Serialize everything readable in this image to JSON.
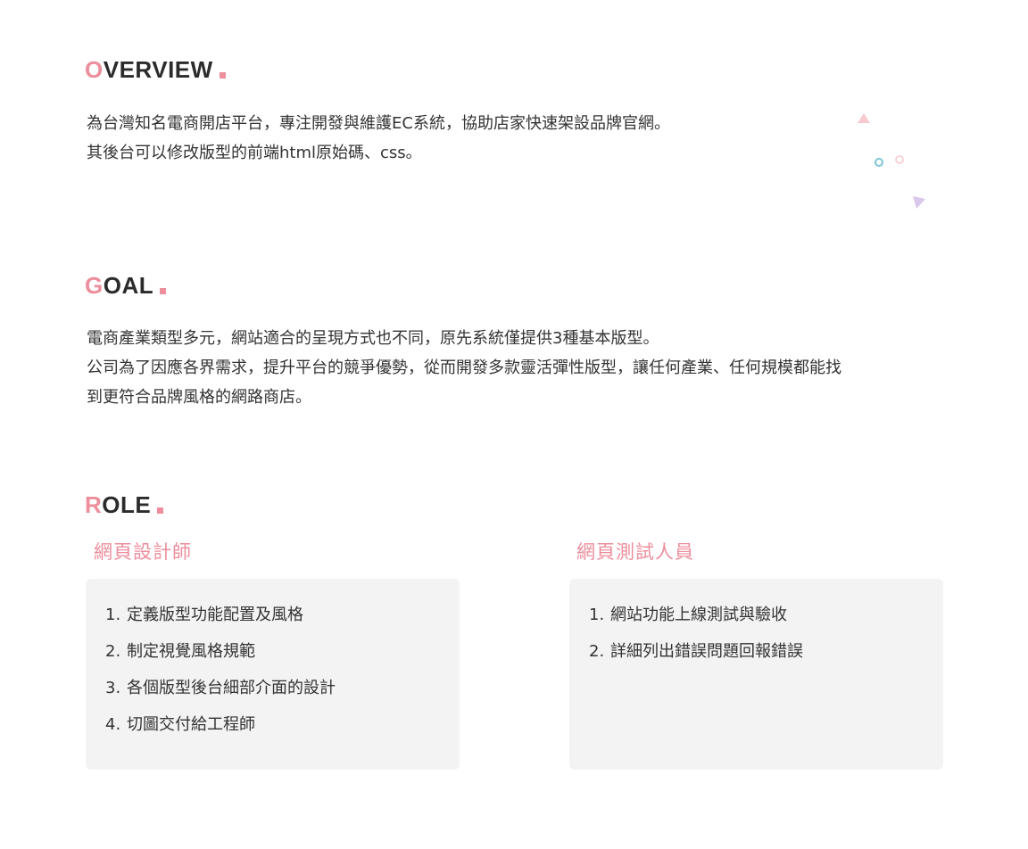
{
  "overview": {
    "initial": "O",
    "title_rest": "VERVIEW",
    "lines": [
      "為台灣知名電商開店平台，專注開發與維護EC系統，協助店家快速架設品牌官網。",
      "其後台可以修改版型的前端html原始碼、css。"
    ]
  },
  "goal": {
    "initial": "G",
    "title_rest": "OAL",
    "lines": [
      "電商產業類型多元，網站適合的呈現方式也不同，原先系統僅提供3種基本版型。",
      "公司為了因應各界需求，提升平台的競爭優勢，從而開發多款靈活彈性版型，讓任何產業、任何規模都能找",
      "到更符合品牌風格的網路商店。"
    ]
  },
  "role": {
    "initial": "R",
    "title_rest": "OLE",
    "designer": {
      "heading": "網頁設計師",
      "items": [
        {
          "num": "1.",
          "text": "定義版型功能配置及風格"
        },
        {
          "num": "2.",
          "text": "制定視覺風格規範"
        },
        {
          "num": "3.",
          "text": "各個版型後台細部介面的設計"
        },
        {
          "num": "4.",
          "text": "切圖交付給工程師"
        }
      ]
    },
    "tester": {
      "heading": "網頁測試人員",
      "items": [
        {
          "num": "1.",
          "text": "網站功能上線測試與驗收"
        },
        {
          "num": "2.",
          "text": "詳細列出錯誤問題回報錯誤"
        }
      ]
    }
  },
  "colors": {
    "accent": "#ec8e9c",
    "text": "#333333",
    "box_bg": "#f3f3f3",
    "deco_teal": "#7cc6d6",
    "deco_purple": "#d9c8ec"
  }
}
